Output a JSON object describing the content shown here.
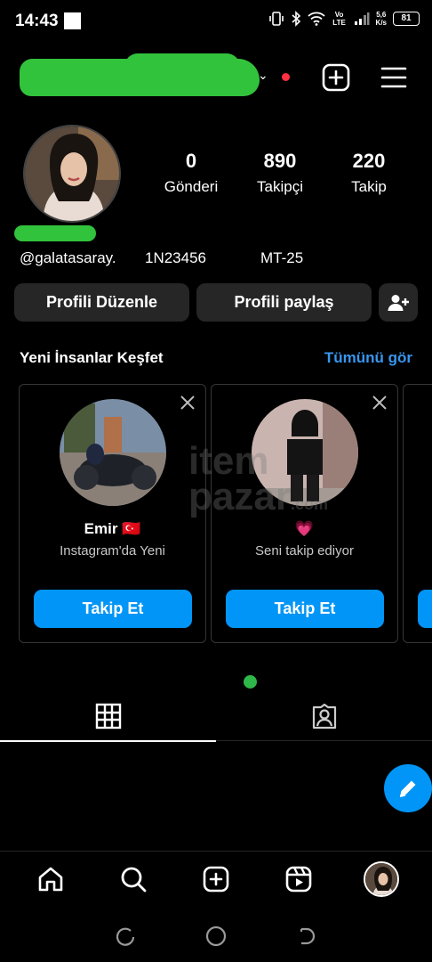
{
  "status_bar": {
    "time": "14:43",
    "network_label": "Vo LTE",
    "speed_value": "5,6",
    "speed_unit": "K/s",
    "battery": "81"
  },
  "profile": {
    "stats": [
      {
        "value": "0",
        "label": "Gönderi"
      },
      {
        "value": "890",
        "label": "Takipçi"
      },
      {
        "value": "220",
        "label": "Takip"
      }
    ],
    "bio": [
      "@galatasaray.",
      "1N23456",
      "MT-25"
    ],
    "edit_button": "Profili Düzenle",
    "share_button": "Profili paylaş"
  },
  "discover": {
    "title": "Yeni İnsanlar Keşfet",
    "see_all": "Tümünü gör",
    "cards": [
      {
        "name": "Emir 🇹🇷",
        "subtitle": "Instagram'da Yeni",
        "button": "Takip Et"
      },
      {
        "name": "💗",
        "subtitle": "Seni takip ediyor",
        "button": "Takip Et"
      }
    ]
  },
  "watermark": {
    "line1": "item",
    "line2": "pazar",
    "suffix": ".com"
  },
  "colors": {
    "accent": "#0095f6",
    "link": "#3797f0",
    "notification": "#ff3040",
    "online": "#2fb84a"
  },
  "icons": {
    "header": [
      "plus-square-icon",
      "menu-icon"
    ],
    "tabs": [
      "grid-icon",
      "tagged-icon"
    ],
    "nav": [
      "home-icon",
      "search-icon",
      "create-icon",
      "reels-icon",
      "profile-avatar"
    ]
  }
}
